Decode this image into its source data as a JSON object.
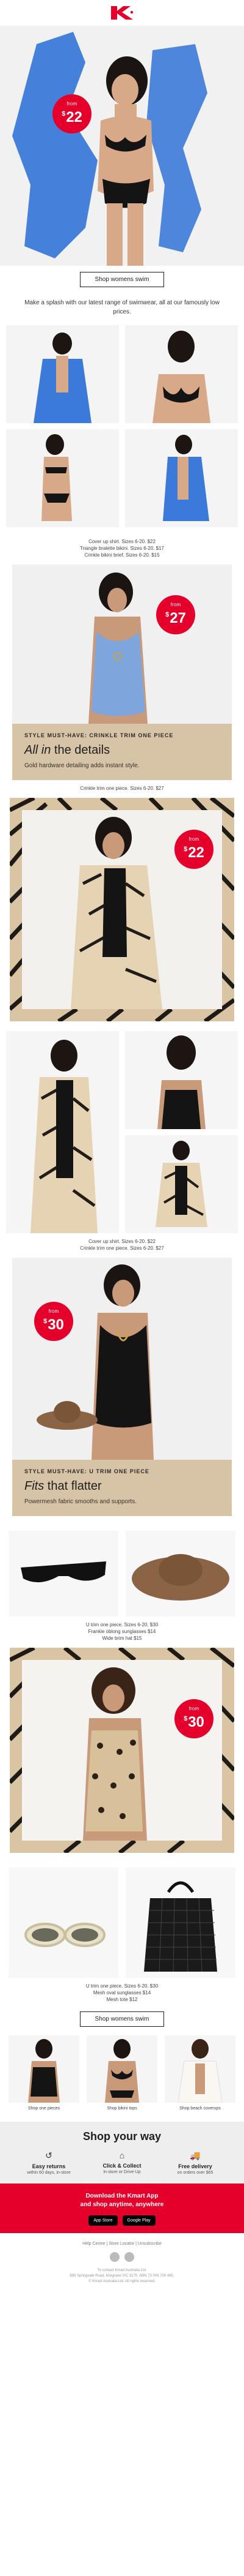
{
  "brand": {
    "name": "Kmart",
    "color": "#e4002b"
  },
  "price_badges": {
    "from": "from",
    "hero": "22",
    "crinkle": "27",
    "zebra": "22",
    "u_trim": "30",
    "leopard": "30"
  },
  "cta": {
    "shop_swim": "Shop womens swim"
  },
  "intro": "Make a splash with our latest range of swimwear, all at our famously low prices.",
  "captions": {
    "grid1": [
      "Cover up shirt. Sizes 6-20. $22",
      "Triangle bralette bikini. Sizes 6-20. $17",
      "Crinkle bikini brief. Sizes 6-20. $15"
    ],
    "crinkle": [
      "Crinkle trim one piece. Sizes 6-20. $27"
    ],
    "grid2": [
      "Cover up shirt. Sizes 6-20. $22",
      "Crinkle trim one piece. Sizes 6-20. $27"
    ],
    "accessories": [
      "U trim one piece. Sizes 6-20. $30",
      "Frankie oblong sunglasses $14",
      "Wide brim hat $15"
    ],
    "bottom": [
      "U trim one piece. Sizes 6-20. $30",
      "Mesh oval sunglasses $14",
      "Mesh tote $12"
    ]
  },
  "features": {
    "crinkle": {
      "kicker": "STYLE MUST-HAVE: CRINKLE TRIM ONE PIECE",
      "head_em": "All in",
      "head_rest": " the details",
      "sub": "Gold hardware detailing adds instant style."
    },
    "u_trim": {
      "kicker": "STYLE MUST-HAVE: U TRIM ONE PIECE",
      "head_em": "Fits",
      "head_rest": " that flatter",
      "sub": "Powermesh fabric smooths and supports."
    }
  },
  "bottom_labels": [
    "Shop one pieces",
    "Shop bikini tops",
    "Shop beach coverups"
  ],
  "shop_way": {
    "title": "Shop your way",
    "items": [
      {
        "icon": "return-icon",
        "glyph": "↺",
        "title": "Easy returns",
        "sub": "within 60 days, in-store"
      },
      {
        "icon": "store-icon",
        "glyph": "⌂",
        "title": "Click & Collect",
        "sub": "in-store or Drive-Up"
      },
      {
        "icon": "truck-icon",
        "glyph": "🚚",
        "title": "Free delivery",
        "sub": "on orders over $65"
      }
    ]
  },
  "app": {
    "line1": "Download the Kmart App",
    "line2": "and shop anytime, anywhere",
    "stores": [
      "App Store",
      "Google Play"
    ]
  },
  "footer": {
    "links": "Help Centre  |  Store Locator  |  Unsubscribe",
    "legal1": "To contact Kmart Australia Ltd.",
    "legal2": "690 Springvale Road, Mulgrave VIC 3170. ABN 73 004 700 485.",
    "legal3": "© Kmart Australia Ltd. All rights reserved."
  }
}
